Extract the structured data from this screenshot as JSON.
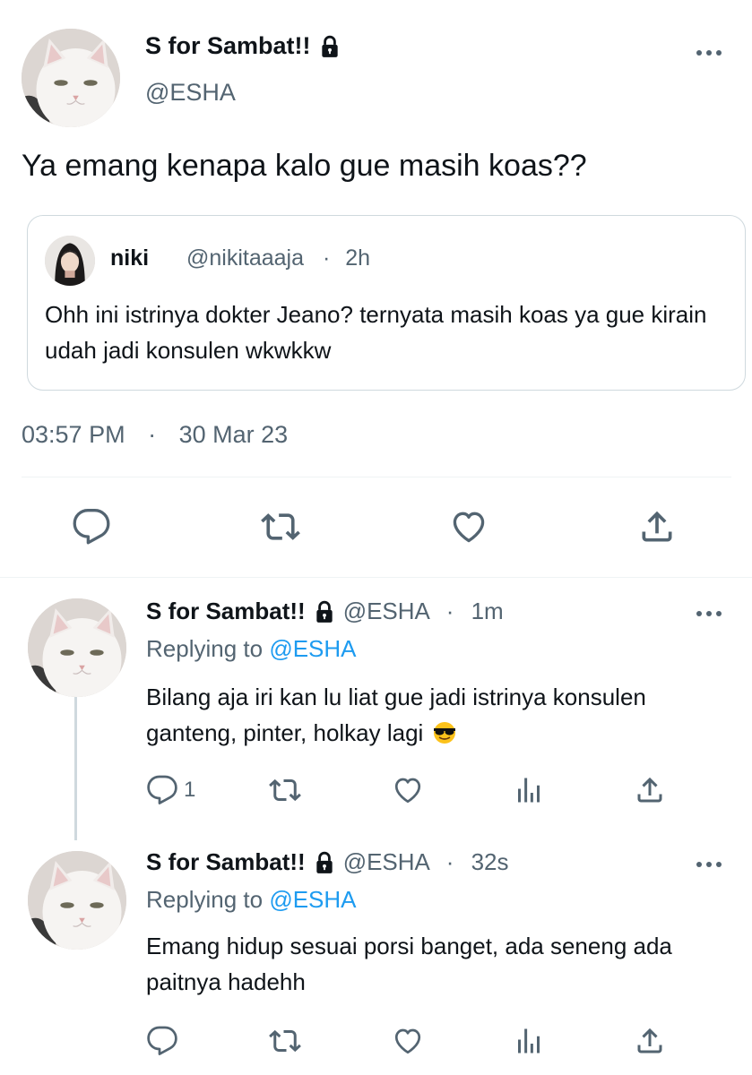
{
  "main_tweet": {
    "display_name": "S for Sambat!!",
    "handle": "@ESHA",
    "text": "Ya emang kenapa kalo gue masih koas??",
    "timestamp": "03:57 PM",
    "date": "30 Mar 23",
    "quote": {
      "display_name": "niki",
      "handle": "@nikitaaaja",
      "separator": "·",
      "time": "2h",
      "text": "Ohh ini istrinya dokter Jeano? ternyata masih koas ya gue kirain udah jadi konsulen wkwkkw"
    }
  },
  "replies": [
    {
      "display_name": "S for Sambat!!",
      "handle": "@ESHA",
      "separator": "·",
      "time": "1m",
      "replying_prefix": "Replying to",
      "replying_to": "@ESHA",
      "text": "Bilang aja iri kan lu liat gue jadi istrinya konsulen ganteng, pinter, holkay lagi",
      "reply_count": "1"
    },
    {
      "display_name": "S for Sambat!!",
      "handle": "@ESHA",
      "separator": "·",
      "time": "32s",
      "replying_prefix": "Replying to",
      "replying_to": "@ESHA",
      "text": "Emang hidup sesuai porsi banget, ada seneng ada paitnya hadehh",
      "reply_count": ""
    }
  ],
  "separator": "·",
  "icons": [
    "reply-icon",
    "retweet-icon",
    "like-icon",
    "share-icon",
    "views-icon",
    "lock-icon",
    "more-icon",
    "sunglasses-emoji"
  ],
  "colors": {
    "text": "#0f1419",
    "muted": "#536471",
    "link": "#1d9bf0",
    "border": "#cfd9de"
  }
}
